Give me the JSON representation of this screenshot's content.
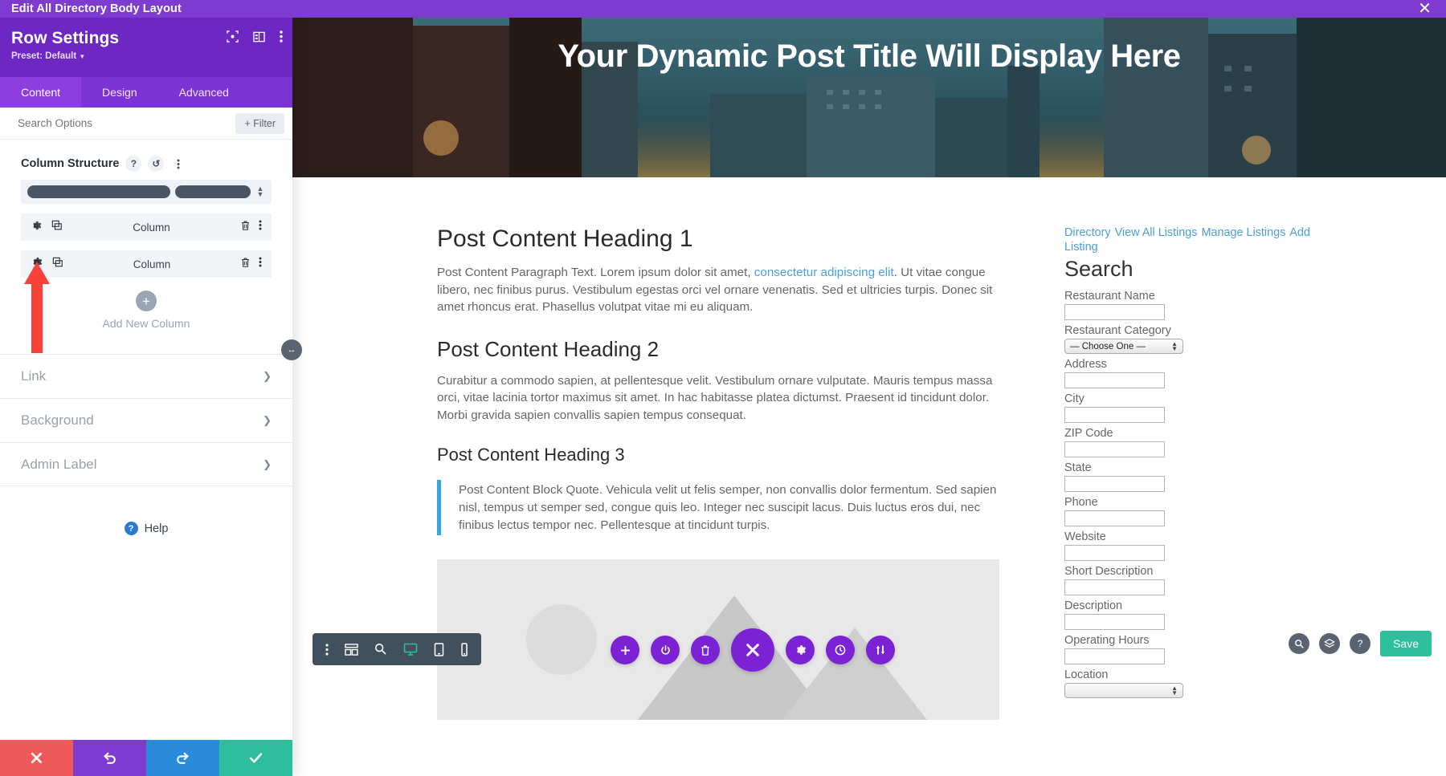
{
  "titlebar": {
    "title": "Edit All Directory Body Layout",
    "close_icon": "close-icon"
  },
  "panel": {
    "heading": "Row Settings",
    "preset": "Preset: Default",
    "tabs": [
      {
        "label": "Content",
        "active": true
      },
      {
        "label": "Design",
        "active": false
      },
      {
        "label": "Advanced",
        "active": false
      }
    ],
    "search_placeholder": "Search Options",
    "filter_label": "Filter",
    "column_structure": {
      "title": "Column Structure"
    },
    "columns": [
      {
        "label": "Column"
      },
      {
        "label": "Column"
      }
    ],
    "add_column_label": "Add New Column",
    "accordions": [
      {
        "label": "Link"
      },
      {
        "label": "Background"
      },
      {
        "label": "Admin Label"
      }
    ],
    "help_label": "Help",
    "footer": {
      "cancel": "cancel-icon",
      "undo": "undo-icon",
      "redo": "redo-icon",
      "save": "check-icon"
    }
  },
  "preview": {
    "hero_title": "Your Dynamic Post Title Will Display Here",
    "main": {
      "heading1": "Post Content Heading 1",
      "paragraph1_pre": "Post Content Paragraph Text. Lorem ipsum dolor sit amet, ",
      "paragraph1_link": "consectetur adipiscing elit",
      "paragraph1_post": ". Ut vitae congue libero, nec finibus purus. Vestibulum egestas orci vel ornare venenatis. Sed et ultricies turpis. Donec sit amet rhoncus erat. Phasellus volutpat vitae mi eu aliquam.",
      "heading2": "Post Content Heading 2",
      "paragraph2": "Curabitur a commodo sapien, at pellentesque velit. Vestibulum ornare vulputate. Mauris tempus massa orci, vitae lacinia tortor maximus sit amet. In hac habitasse platea dictumst. Praesent id tincidunt dolor. Morbi gravida sapien convallis sapien tempus consequat.",
      "heading3": "Post Content Heading 3",
      "blockquote": "Post Content Block Quote. Vehicula velit ut felis semper, non convallis dolor fermentum. Sed sapien nisl, tempus ut semper sed, congue quis leo. Integer nec suscipit lacus. Duis luctus eros dui, nec finibus lectus tempor nec. Pellentesque at tincidunt turpis."
    },
    "sidebar": {
      "nav_links": [
        "Directory",
        "View All Listings",
        "Manage Listings",
        "Add Listing"
      ],
      "search_heading": "Search",
      "fields": [
        {
          "label": "Restaurant Name",
          "type": "text",
          "value": ""
        },
        {
          "label": "Restaurant Category",
          "type": "select",
          "value": "— Choose One —"
        },
        {
          "label": "Address",
          "type": "text",
          "value": ""
        },
        {
          "label": "City",
          "type": "text",
          "value": ""
        },
        {
          "label": "ZIP Code",
          "type": "text",
          "value": ""
        },
        {
          "label": "State",
          "type": "text",
          "value": ""
        },
        {
          "label": "Phone",
          "type": "text",
          "value": ""
        },
        {
          "label": "Website",
          "type": "text",
          "value": ""
        },
        {
          "label": "Short Description",
          "type": "text",
          "value": ""
        },
        {
          "label": "Description",
          "type": "text",
          "value": ""
        },
        {
          "label": "Operating Hours",
          "type": "text",
          "value": ""
        },
        {
          "label": "Location",
          "type": "select",
          "value": ""
        }
      ]
    }
  },
  "view_toolbar": {
    "items": [
      {
        "icon": "more-options-icon",
        "active": false
      },
      {
        "icon": "wireframe-icon",
        "active": false
      },
      {
        "icon": "zoom-out-icon",
        "active": false
      },
      {
        "icon": "desktop-icon",
        "active": true
      },
      {
        "icon": "tablet-icon",
        "active": false
      },
      {
        "icon": "phone-icon",
        "active": false
      }
    ]
  },
  "round_bar": {
    "items": [
      {
        "icon": "add-icon",
        "big": false
      },
      {
        "icon": "power-icon",
        "big": false
      },
      {
        "icon": "trash-icon",
        "big": false
      },
      {
        "icon": "close-icon",
        "big": true
      },
      {
        "icon": "gear-icon",
        "big": false
      },
      {
        "icon": "history-icon",
        "big": false
      },
      {
        "icon": "sort-icon",
        "big": false
      }
    ]
  },
  "bottom_right": {
    "search_icon": "zoom-icon",
    "layers_icon": "layers-icon",
    "help_icon": "help-icon",
    "save_label": "Save"
  },
  "colors": {
    "purple_bar": "#7e3bd0",
    "purple_head": "#6d28c4",
    "tab_active": "#8d3de0",
    "accent_teal": "#2dbf9c",
    "link_blue": "#4a9fd8",
    "arrow_red": "#f9423a"
  }
}
